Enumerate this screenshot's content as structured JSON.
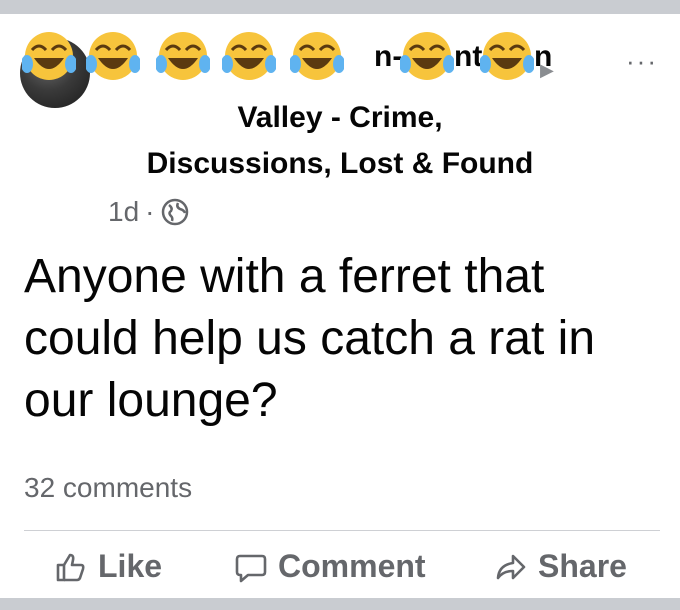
{
  "post": {
    "group_name_line1": "Valley - Crime,",
    "group_name_line2": "Discussions, Lost & Found",
    "time": "1d",
    "separator": "·",
    "privacy_icon": "globe-icon",
    "more_icon": "more-options-icon",
    "more_label": "···",
    "text": "Anyone with a ferret that could help us catch a rat in our lounge?",
    "comments_count": "32 comments",
    "obscured_name_emoji": "laughing-tears-emoji"
  },
  "actions": {
    "like_label": "Like",
    "comment_label": "Comment",
    "share_label": "Share"
  },
  "colors": {
    "text_primary": "#050505",
    "text_secondary": "#65676b",
    "divider": "#ced0d4",
    "frame": "#c9ccd1",
    "emoji_face": "#f7c43c"
  }
}
